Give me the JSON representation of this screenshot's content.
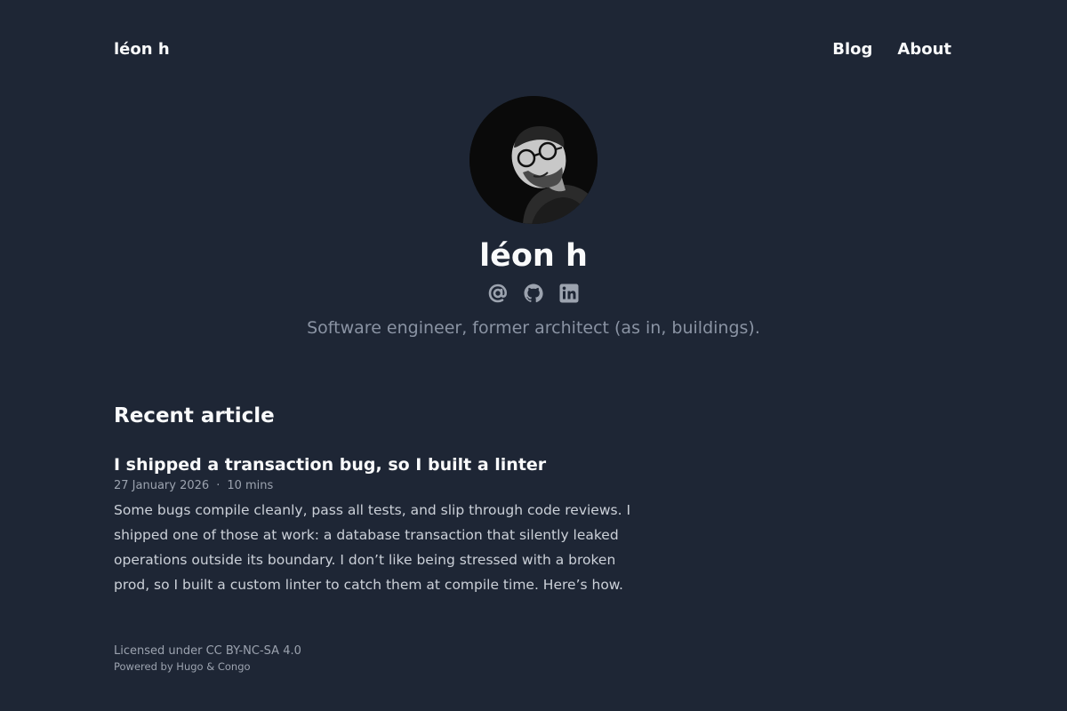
{
  "header": {
    "site_title": "léon h",
    "nav": [
      {
        "label": "Blog"
      },
      {
        "label": "About"
      }
    ]
  },
  "profile": {
    "name": "léon h",
    "tagline": "Software engineer, former architect (as in, buildings).",
    "socials": [
      {
        "icon": "at-icon"
      },
      {
        "icon": "github-icon"
      },
      {
        "icon": "linkedin-icon"
      }
    ]
  },
  "recent": {
    "heading": "Recent article",
    "article": {
      "title": "I shipped a transaction bug, so I built a linter",
      "date": "27 January 2026",
      "separator": "·",
      "read_time": "10 mins",
      "summary": "Some bugs compile cleanly, pass all tests, and slip through code reviews. I shipped one of those at work: a database transaction that silently leaked operations outside its boundary. I don’t like being stressed with a broken prod, so I built a custom linter to catch them at compile time. Here’s how."
    }
  },
  "footer": {
    "license": "Licensed under CC BY-NC-SA 4.0",
    "powered": "Powered by Hugo & Congo"
  },
  "colors": {
    "background": "#1e2635",
    "text": "#f9fafb",
    "muted": "#9ca3af"
  }
}
